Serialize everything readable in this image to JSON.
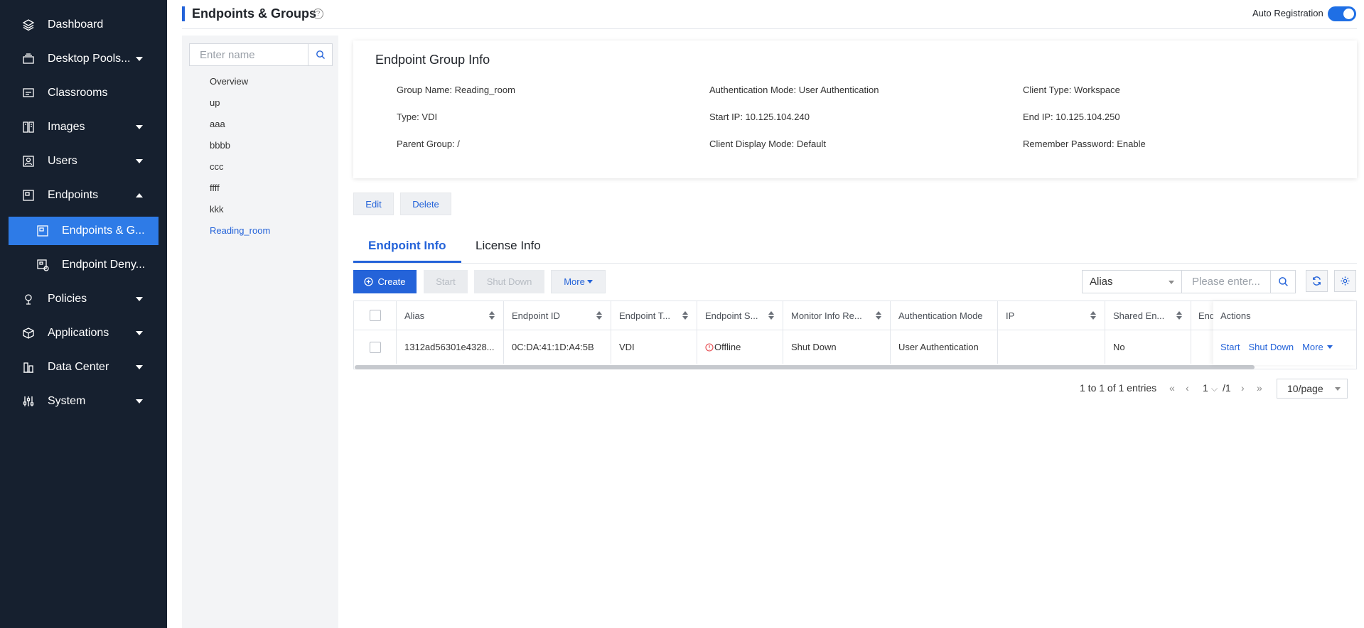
{
  "sidebar": {
    "items": [
      {
        "label": "Dashboard",
        "icon": "layers-icon"
      },
      {
        "label": "Desktop Pools...",
        "icon": "desktop-pool-icon"
      },
      {
        "label": "Classrooms",
        "icon": "classroom-icon"
      },
      {
        "label": "Images",
        "icon": "images-icon"
      },
      {
        "label": "Users",
        "icon": "users-icon"
      },
      {
        "label": "Endpoints",
        "icon": "endpoints-icon"
      },
      {
        "label": "Policies",
        "icon": "policies-icon"
      },
      {
        "label": "Applications",
        "icon": "applications-icon"
      },
      {
        "label": "Data Center",
        "icon": "data-center-icon"
      },
      {
        "label": "System",
        "icon": "system-icon"
      }
    ],
    "sub_items": [
      {
        "label": "Endpoints & G...",
        "icon": "endpoint-group-icon",
        "active": true
      },
      {
        "label": "Endpoint Deny...",
        "icon": "endpoint-deny-icon",
        "active": false
      }
    ]
  },
  "header": {
    "title": "Endpoints & Groups",
    "help": "?",
    "auto_registration_label": "Auto Registration",
    "auto_registration_on": true
  },
  "tree": {
    "search_placeholder": "Enter name",
    "items": [
      "Overview",
      "up",
      "aaa",
      "bbbb",
      "ccc",
      "ffff",
      "kkk",
      "Reading_room"
    ],
    "selected": "Reading_room"
  },
  "info": {
    "title": "Endpoint Group Info",
    "fields": {
      "group_name": "Group Name:   Reading_room",
      "auth_mode": "Authentication Mode:   User Authentication",
      "client_type": "Client Type:   Workspace",
      "type": "Type:   VDI",
      "start_ip": "Start IP:   10.125.104.240",
      "end_ip": "End IP:   10.125.104.250",
      "parent_group": "Parent Group:   /",
      "client_display_mode": "Client Display Mode:   Default",
      "remember_password": "Remember Password:   Enable"
    },
    "edit_label": "Edit",
    "delete_label": "Delete"
  },
  "tabs": [
    {
      "label": "Endpoint Info",
      "active": true
    },
    {
      "label": "License Info",
      "active": false
    }
  ],
  "toolbar": {
    "create_label": "Create",
    "start_label": "Start",
    "shutdown_label": "Shut Down",
    "more_label": "More",
    "filter_select": "Alias",
    "search_placeholder": "Please enter..."
  },
  "table": {
    "headers": [
      "Alias",
      "Endpoint ID",
      "Endpoint T...",
      "Endpoint S...",
      "Monitor Info Re...",
      "Authentication Mode",
      "IP",
      "Shared En...",
      "End",
      "Actions"
    ],
    "rows": [
      {
        "alias": "1312ad56301e4328...",
        "endpoint_id": "0C:DA:41:1D:A4:5B",
        "endpoint_type": "VDI",
        "endpoint_status": "Offline",
        "monitor_info": "Shut Down",
        "auth_mode": "User Authentication",
        "ip": "",
        "shared": "No",
        "actions": {
          "start": "Start",
          "shutdown": "Shut Down",
          "more": "More"
        }
      }
    ],
    "status_color": "#e5484d"
  },
  "pagination": {
    "summary": "1 to 1 of 1 entries",
    "current_page": "1",
    "total_pages": "/1",
    "page_size": "10/page"
  },
  "colors": {
    "accent": "#2463d9",
    "sidebar_bg": "#16202f",
    "sidebar_active": "#2e7be7"
  }
}
